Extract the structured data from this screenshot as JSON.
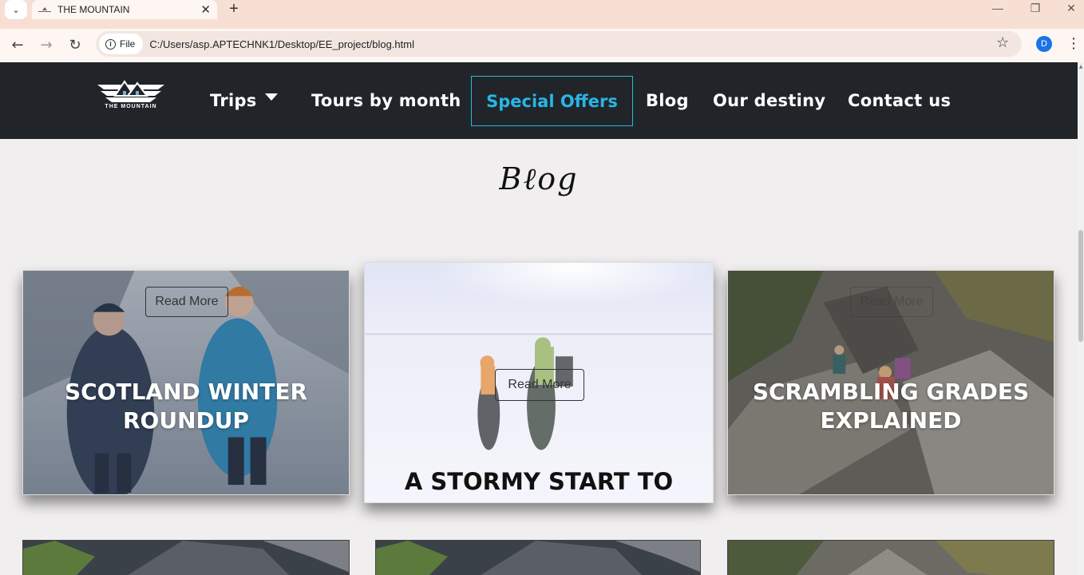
{
  "browser": {
    "tab_title": "THE MOUNTAIN",
    "tab_close": "✕",
    "new_tab": "+",
    "site_chip": "File",
    "url": "C:/Users/asp.APTECHNK1/Desktop/EE_project/blog.html",
    "profile_initial": "D"
  },
  "nav": {
    "logo_text": "THE MOUNTAIN",
    "items": [
      {
        "label": "Trips"
      },
      {
        "label": "Tours by month"
      },
      {
        "label": "Special Offers"
      },
      {
        "label": "Blog"
      },
      {
        "label": "Our destiny"
      },
      {
        "label": "Contact us"
      }
    ]
  },
  "page": {
    "title": "Bℓog"
  },
  "cards": [
    {
      "title": "SCOTLAND WINTER ROUNDUP",
      "button": "Read More"
    },
    {
      "title": "A STORMY START TO",
      "button": "Read More"
    },
    {
      "title": "SCRAMBLING GRADES EXPLAINED",
      "button": "Read More"
    }
  ],
  "colors": {
    "nav_bg": "#212529",
    "accent": "#29b6e6",
    "page_bg": "#f0eeee",
    "tabstrip": "#f8dfd3"
  }
}
